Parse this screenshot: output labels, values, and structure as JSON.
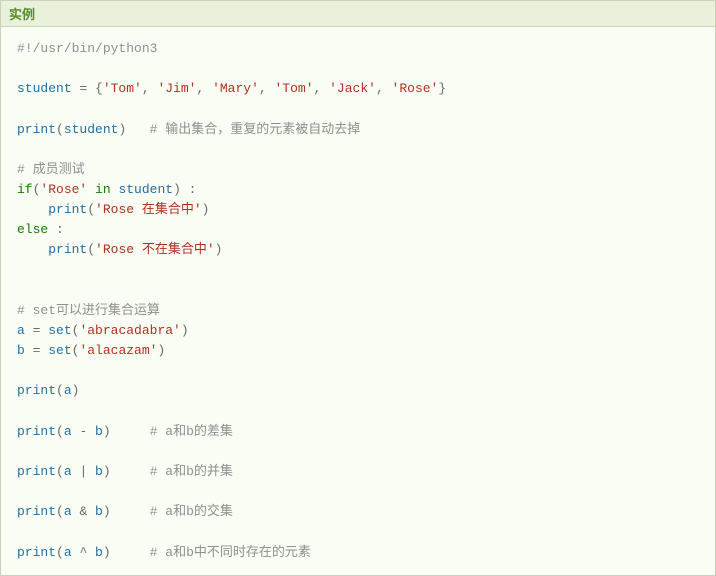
{
  "header": {
    "title": "实例"
  },
  "code": {
    "shebang": "#!/usr/bin/python3",
    "blank": "",
    "l_student": "student",
    "l_eq": " = ",
    "l_lbrace": "{",
    "l_rbrace": "}",
    "s_tom": "'Tom'",
    "s_jim": "'Jim'",
    "s_mary": "'Mary'",
    "s_jack": "'Jack'",
    "s_rose": "'Rose'",
    "comma": ", ",
    "print": "print",
    "lparen": "(",
    "rparen": ")",
    "c1": "# 输出集合，重复的元素被自动去掉",
    "c2": "# 成员测试",
    "if": "if",
    "in": " in ",
    "colon_sp": " :",
    "s_rose_in": "'Rose 在集合中'",
    "else": "else",
    "s_rose_notin": "'Rose 不在集合中'",
    "c3": "# set可以进行集合运算",
    "a": "a",
    "b": "b",
    "set": "set",
    "s_abra": "'abracadabra'",
    "s_alac": "'alacazam'",
    "minus": " - ",
    "bar": " | ",
    "amp": " & ",
    "caret": " ^ ",
    "c_diff": "# a和b的差集",
    "c_union": "# a和b的并集",
    "c_inter": "# a和b的交集",
    "c_sym": "# a和b中不同时存在的元素",
    "pad3": "   ",
    "pad4": "    ",
    "pad5": "     "
  }
}
